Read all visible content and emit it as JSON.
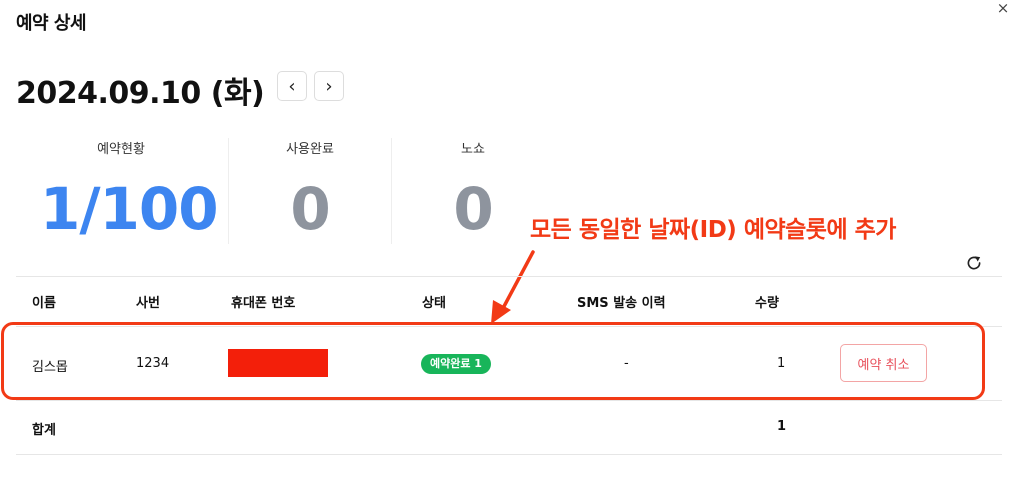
{
  "modal": {
    "title": "예약 상세",
    "close_icon": "×"
  },
  "date_header": {
    "date": "2024.09.10 (화)",
    "prev_icon": "‹",
    "next_icon": "›"
  },
  "stats": [
    {
      "label": "예약현황",
      "value": "1/100",
      "color": "#3d85f0"
    },
    {
      "label": "사용완료",
      "value": "0",
      "color": "#8e949e"
    },
    {
      "label": "노쇼",
      "value": "0",
      "color": "#8e949e"
    }
  ],
  "annotation": {
    "text": "모든 동일한 날짜(ID) 예약슬롯에 추가",
    "color": "#f23a16"
  },
  "table": {
    "headers": {
      "name": "이름",
      "employee_no": "사번",
      "phone": "휴대폰 번호",
      "status": "상태",
      "sms_history": "SMS 발송 이력",
      "quantity": "수량"
    },
    "rows": [
      {
        "name": "김스몹",
        "employee_no": "1234",
        "phone": "",
        "status_badge": "예약완료 1",
        "sms_history": "-",
        "quantity": "1",
        "cancel_label": "예약 취소"
      }
    ],
    "total": {
      "label": "합계",
      "quantity": "1"
    }
  },
  "colors": {
    "badge_green": "#18b55a",
    "cancel_red": "#e8505b",
    "annotation_red": "#f23a16",
    "redaction_red": "#f31f0a"
  }
}
